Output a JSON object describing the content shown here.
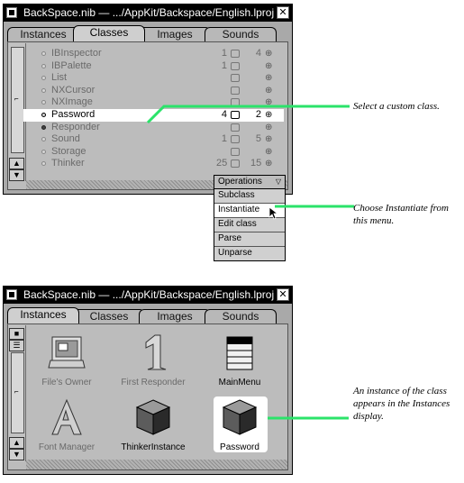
{
  "window1": {
    "title": "BackSpace.nib — .../AppKit/Backspace/English.lproj",
    "tabs": [
      "Instances",
      "Classes",
      "Images",
      "Sounds"
    ],
    "active_tab": "Classes",
    "classes": [
      {
        "name": "IBInspector",
        "count1": "1",
        "count2": "4",
        "dark": false,
        "selected": false
      },
      {
        "name": "IBPalette",
        "count1": "1",
        "count2": "",
        "dark": false,
        "selected": false
      },
      {
        "name": "List",
        "count1": "",
        "count2": "",
        "dark": false,
        "selected": false
      },
      {
        "name": "NXCursor",
        "count1": "",
        "count2": "",
        "dark": false,
        "selected": false
      },
      {
        "name": "NXImage",
        "count1": "",
        "count2": "",
        "dark": false,
        "selected": false
      },
      {
        "name": "Password",
        "count1": "4",
        "count2": "2",
        "dark": false,
        "selected": true
      },
      {
        "name": "Responder",
        "count1": "",
        "count2": "",
        "dark": true,
        "selected": false
      },
      {
        "name": "Sound",
        "count1": "1",
        "count2": "5",
        "dark": false,
        "selected": false
      },
      {
        "name": "Storage",
        "count1": "",
        "count2": "",
        "dark": false,
        "selected": false
      },
      {
        "name": "Thinker",
        "count1": "25",
        "count2": "15",
        "dark": false,
        "selected": false
      }
    ]
  },
  "operations_menu": {
    "title": "Operations",
    "items": [
      "Subclass",
      "Instantiate",
      "Edit class",
      "Parse",
      "Unparse"
    ],
    "highlighted": "Instantiate"
  },
  "callouts": {
    "select": "Select a custom class.",
    "choose": "Choose Instantiate from this menu.",
    "instance": "An instance of the class appears in the Instances display."
  },
  "window2": {
    "title": "BackSpace.nib — .../AppKit/Backspace/English.lproj",
    "tabs": [
      "Instances",
      "Classes",
      "Images",
      "Sounds"
    ],
    "active_tab": "Instances",
    "instances": [
      {
        "label": "File's Owner",
        "icon": "monitor-icon"
      },
      {
        "label": "First Responder",
        "icon": "numeral-one-icon"
      },
      {
        "label": "MainMenu",
        "icon": "menu-icon"
      },
      {
        "label": "Font Manager",
        "icon": "letter-a-icon"
      },
      {
        "label": "ThinkerInstance",
        "icon": "cube-icon"
      },
      {
        "label": "Password",
        "icon": "cube-icon"
      }
    ]
  },
  "colors": {
    "callout_line": "#2be36a",
    "window_bg": "#a9a9a9",
    "titlebar": "#000000"
  }
}
